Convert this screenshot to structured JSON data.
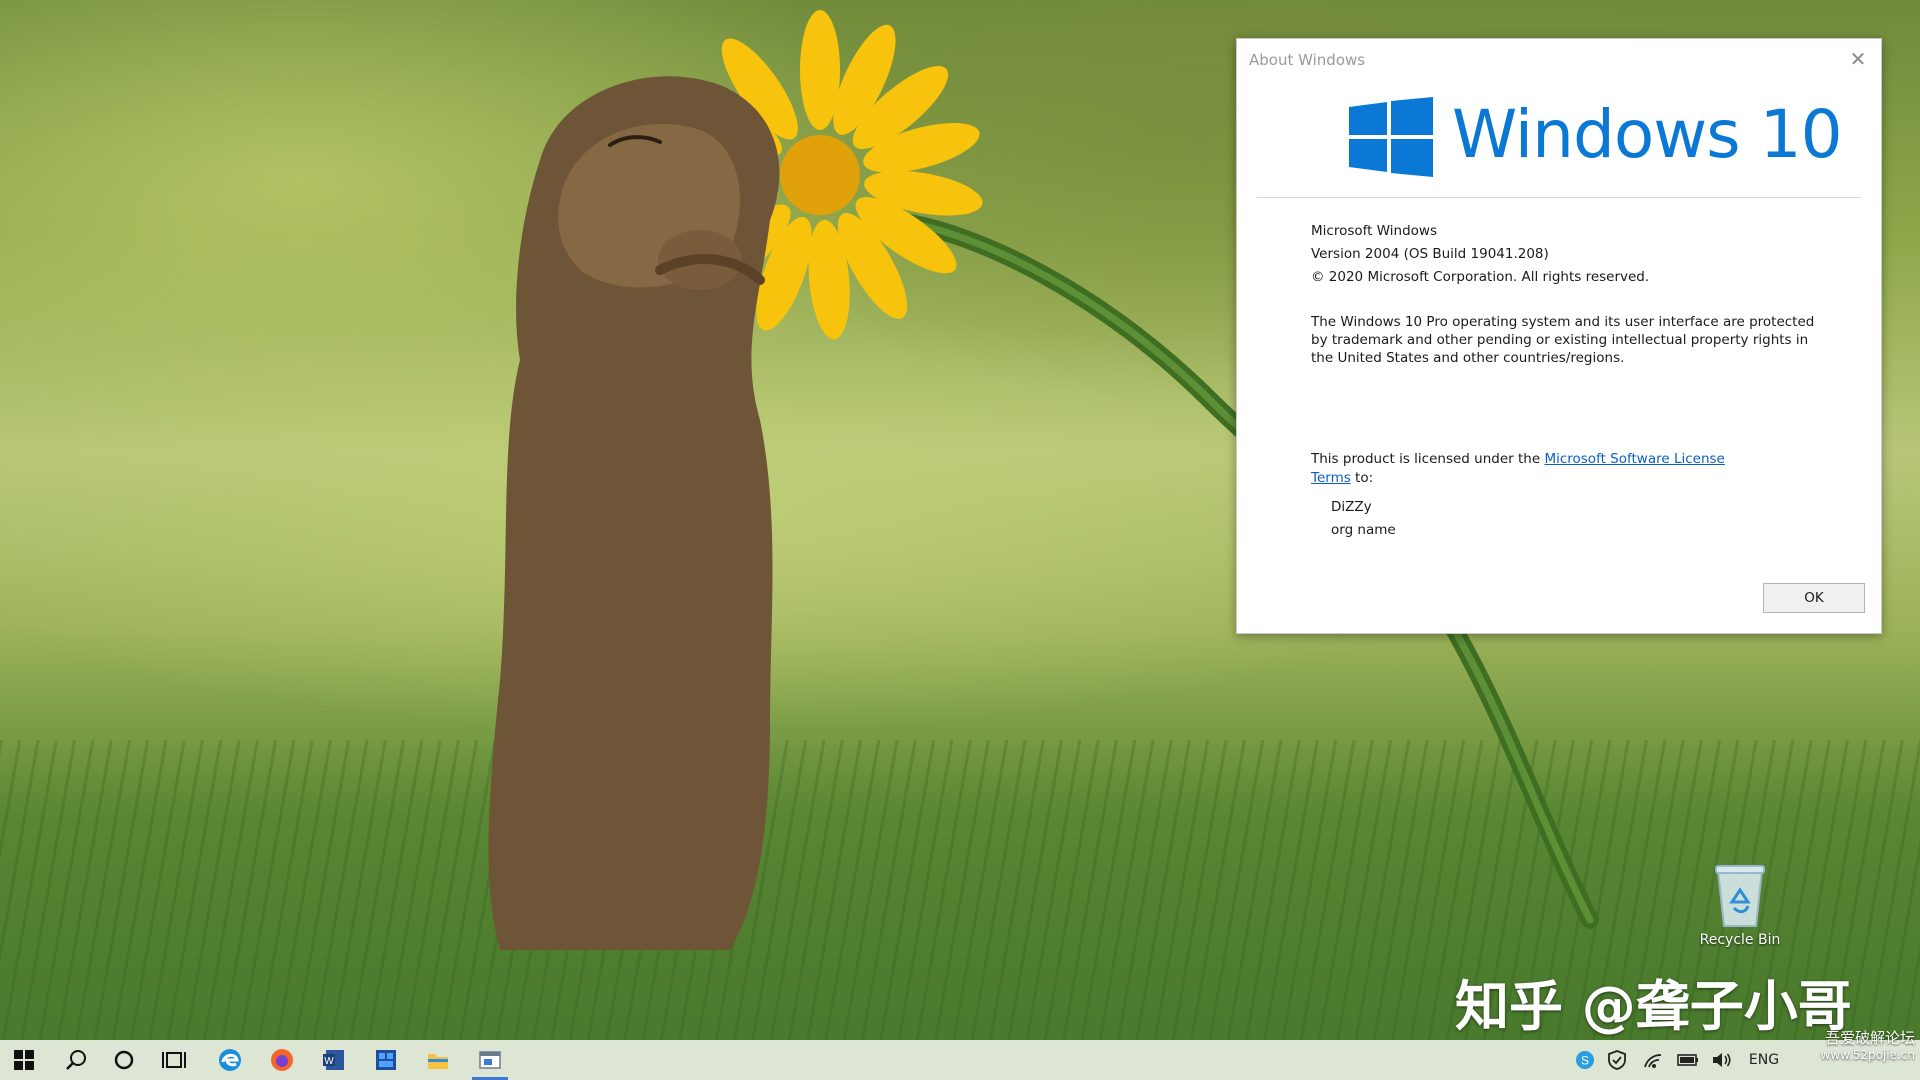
{
  "dialog": {
    "title": "About Windows",
    "close_glyph": "✕",
    "logo_text": "Windows 10",
    "product_name": "Microsoft Windows",
    "version": "Version 2004 (OS Build 19041.208)",
    "copyright": "© 2020 Microsoft Corporation. All rights reserved.",
    "legal": "The Windows 10 Pro operating system and its user interface are protected by trademark and other pending or existing intellectual property rights in the United States and other countries/regions.",
    "license_prefix": "This product is licensed under the ",
    "license_link": "Microsoft Software License Terms",
    "license_suffix": " to:",
    "licensed_user": "DiZZy",
    "licensed_org": "org name",
    "ok_label": "OK"
  },
  "desktop": {
    "recycle_bin_label": "Recycle Bin",
    "watermark": "知乎 @聋子小哥"
  },
  "taskbar": {
    "items": [
      {
        "icon": "windows-start-icon"
      },
      {
        "icon": "search-icon"
      },
      {
        "icon": "cortana-circle-icon"
      },
      {
        "icon": "task-view-icon"
      },
      {
        "icon": "edge-browser-icon"
      },
      {
        "icon": "firefox-icon"
      },
      {
        "icon": "word-icon"
      },
      {
        "icon": "app-window-icon"
      },
      {
        "icon": "file-explorer-icon"
      },
      {
        "icon": "about-windows-app-icon"
      }
    ],
    "tray": {
      "language": "ENG"
    }
  },
  "site_watermark": {
    "line1": "吾爱破解论坛",
    "line2": "www.52pojie.cn"
  },
  "colors": {
    "accent": "#0a78d4",
    "link": "#0a5fc4",
    "taskbar": "#e8eee2"
  }
}
